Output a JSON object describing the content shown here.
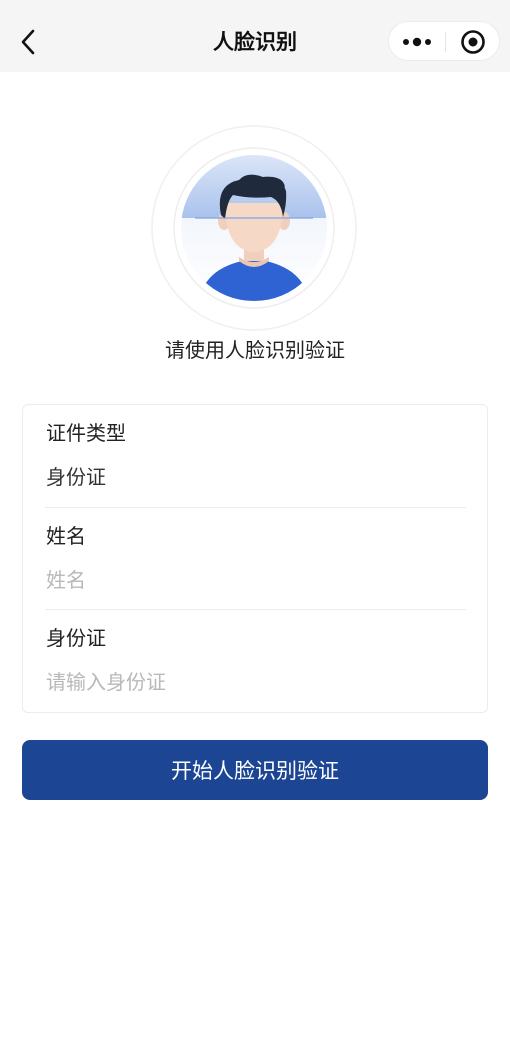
{
  "nav": {
    "title": "人脸识别",
    "back_icon": "chevron-left-icon",
    "more_icon": "more-dots-icon",
    "close_icon": "record-circle-icon"
  },
  "face": {
    "icon": "face-avatar-icon",
    "hint": "请使用人脸识别验证"
  },
  "form": {
    "id_type": {
      "label": "证件类型",
      "value": "身份证"
    },
    "name": {
      "label": "姓名",
      "placeholder": "姓名",
      "value": ""
    },
    "id_number": {
      "label": "身份证",
      "placeholder": "请输入身份证",
      "value": ""
    }
  },
  "actions": {
    "start_label": "开始人脸识别验证"
  },
  "colors": {
    "primary": "#1c4594",
    "nav_bg": "#f5f5f5",
    "placeholder": "#b8b8b8"
  }
}
